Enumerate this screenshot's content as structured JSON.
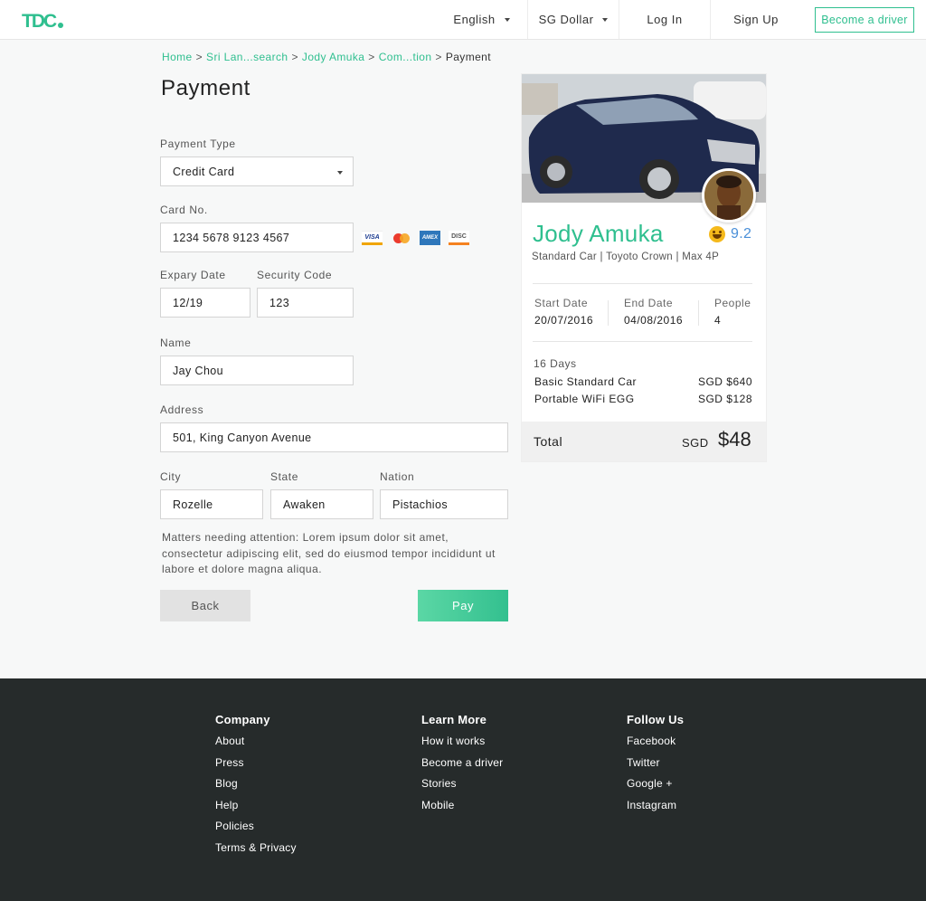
{
  "header": {
    "logo_text": "TDC",
    "language": "English",
    "currency": "SG Dollar",
    "login": "Log In",
    "signup": "Sign Up",
    "become_driver": "Become a driver"
  },
  "breadcrumb": [
    "Home",
    "Sri Lan...search",
    "Jody Amuka",
    "Com...tion",
    "Payment"
  ],
  "page_title": "Payment",
  "form": {
    "payment_type_label": "Payment Type",
    "payment_type_value": "Credit Card",
    "card_no_label": "Card No.",
    "card_no_value": "1234 5678 9123 4567",
    "card_icons": [
      "VISA",
      "mastercard",
      "AMEX",
      "DISC"
    ],
    "expiry_label": "Expary Date",
    "expiry_value": "12/19",
    "security_label": "Security Code",
    "security_value": "123",
    "name_label": "Name",
    "name_value": "Jay Chou",
    "address_label": "Address",
    "address_value": "501, King Canyon Avenue",
    "city_label": "City",
    "city_value": "Rozelle",
    "state_label": "State",
    "state_value": "Awaken",
    "nation_label": "Nation",
    "nation_value": "Pistachios",
    "note": "Matters needing attention: Lorem ipsum dolor sit amet, consectetur adipiscing elit, sed do eiusmod tempor incididunt ut labore et dolore magna aliqua.",
    "back": "Back",
    "pay": "Pay"
  },
  "summary": {
    "driver_name": "Jody Amuka",
    "rating": "9.2",
    "car_desc": "Standard Car | Toyoto Crown | Max 4P",
    "start_label": "Start Date",
    "start_value": "20/07/2016",
    "end_label": "End Date",
    "end_value": "04/08/2016",
    "people_label": "People",
    "people_value": "4",
    "days": "16 Days",
    "items": [
      {
        "name": "Basic Standard Car",
        "price": "SGD $640"
      },
      {
        "name": "Portable WiFi EGG",
        "price": "SGD $128"
      }
    ],
    "total_label": "Total",
    "total_currency": "SGD",
    "total_amount": "$48"
  },
  "footer": {
    "columns": [
      {
        "title": "Company",
        "links": [
          "About",
          "Press",
          "Blog",
          "Help",
          "Policies",
          "Terms & Privacy"
        ]
      },
      {
        "title": "Learn More",
        "links": [
          "How it works",
          "Become a driver",
          "Stories",
          "Mobile"
        ]
      },
      {
        "title": "Follow Us",
        "links": [
          "Facebook",
          "Twitter",
          "Google +",
          "Instagram"
        ]
      }
    ]
  },
  "colors": {
    "accent": "#2fbf8f",
    "footer_bg": "#262b2b",
    "rating": "#4a8fd8"
  }
}
